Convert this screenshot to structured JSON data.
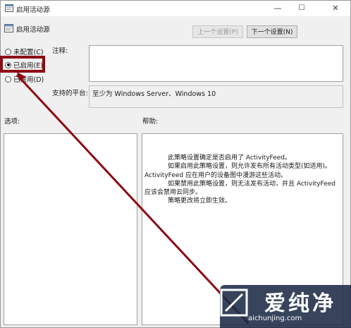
{
  "window": {
    "title": "启用活动源",
    "minimize": "—",
    "maximize": "☐",
    "close": "✕"
  },
  "header": {
    "policy_name": "启用活动源",
    "prev_button": "上一个设置(P)",
    "next_button": "下一个设置(N)"
  },
  "options": {
    "not_configured": "未配置(C)",
    "enabled": "已启用(E)",
    "disabled": "已禁用(D)",
    "selected": "enabled"
  },
  "fields": {
    "comment_label": "注释:",
    "comment_value": "",
    "platform_label": "支持的平台:",
    "platform_value": "至少为 Windows Server、Windows 10",
    "options_label": "选项:",
    "help_label": "帮助:"
  },
  "help": {
    "paragraphs": [
      "此策略设置确定是否启用了 ActivityFeed。",
      "如果启用此策略设置，则允许发布所有活动类型(如适用)。ActivityFeed 应在用户的设备图中漫游这些活动。",
      "如果禁用此策略设置，则无法发布活动，并且 ActivityFeed 应该会禁用云同步。",
      "策略更改将立即生效。"
    ]
  },
  "watermark": {
    "brand": "爱纯净",
    "url": "aichunjing.com"
  },
  "colors": {
    "highlight": "#8c0a14",
    "arrow": "#8c0a14",
    "watermark_bg": "#1b2a44"
  }
}
